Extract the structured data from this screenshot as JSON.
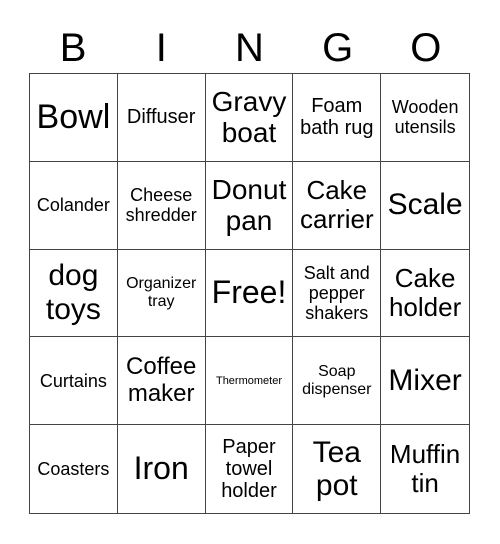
{
  "header": [
    "B",
    "I",
    "N",
    "G",
    "O"
  ],
  "cells": [
    {
      "text": "Bowl",
      "size": 34
    },
    {
      "text": "Diffuser",
      "size": 20
    },
    {
      "text": "Gravy boat",
      "size": 28
    },
    {
      "text": "Foam bath rug",
      "size": 20
    },
    {
      "text": "Wooden utensils",
      "size": 18
    },
    {
      "text": "Colander",
      "size": 18
    },
    {
      "text": "Cheese shredder",
      "size": 18
    },
    {
      "text": "Donut pan",
      "size": 28
    },
    {
      "text": "Cake carrier",
      "size": 26
    },
    {
      "text": "Scale",
      "size": 30
    },
    {
      "text": "dog toys",
      "size": 30
    },
    {
      "text": "Organizer tray",
      "size": 16
    },
    {
      "text": "Free!",
      "size": 32
    },
    {
      "text": "Salt and pepper shakers",
      "size": 18
    },
    {
      "text": "Cake holder",
      "size": 26
    },
    {
      "text": "Curtains",
      "size": 18
    },
    {
      "text": "Coffee maker",
      "size": 24
    },
    {
      "text": "Thermometer",
      "size": 11
    },
    {
      "text": "Soap dispenser",
      "size": 16
    },
    {
      "text": "Mixer",
      "size": 30
    },
    {
      "text": "Coasters",
      "size": 18
    },
    {
      "text": "Iron",
      "size": 32
    },
    {
      "text": "Paper towel holder",
      "size": 20
    },
    {
      "text": "Tea pot",
      "size": 30
    },
    {
      "text": "Muffin tin",
      "size": 26
    }
  ]
}
